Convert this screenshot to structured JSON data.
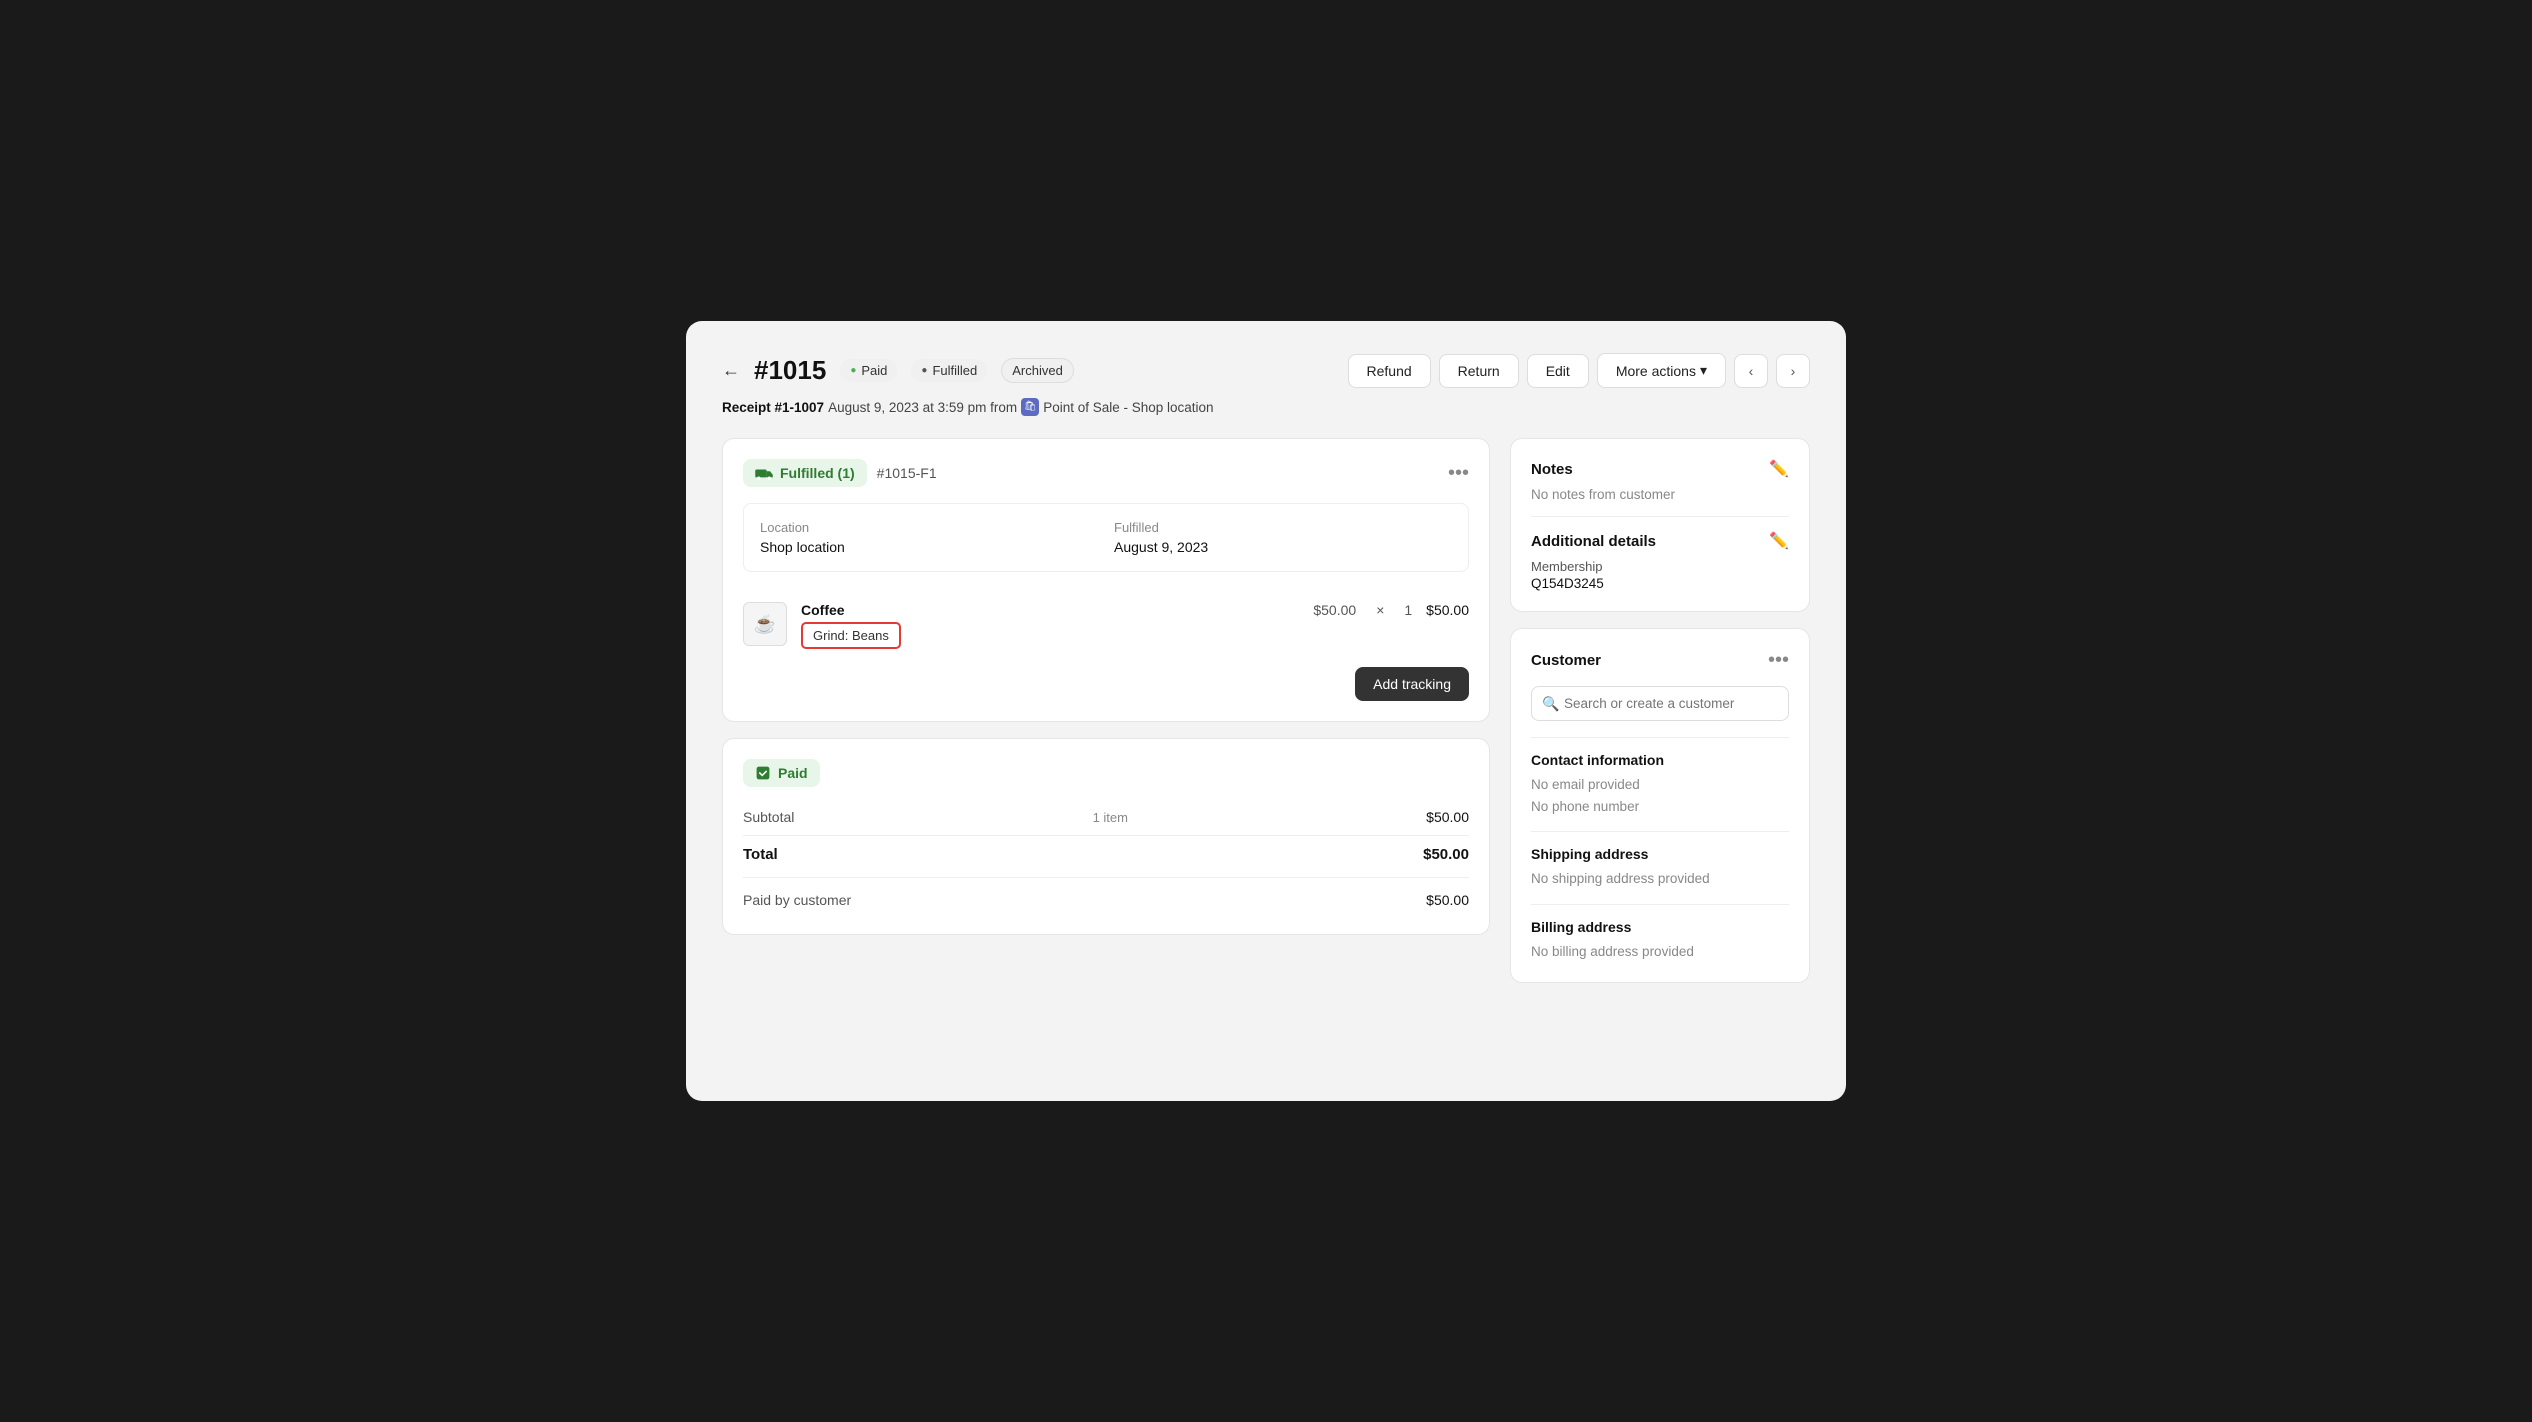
{
  "header": {
    "back_label": "←",
    "order_number": "#1015",
    "badge_paid": "Paid",
    "badge_fulfilled": "Fulfilled",
    "badge_archived": "Archived",
    "btn_refund": "Refund",
    "btn_return": "Return",
    "btn_edit": "Edit",
    "btn_more_actions": "More actions",
    "nav_prev": "‹",
    "nav_next": "›"
  },
  "subheader": {
    "receipt_label": "Receipt #1-1007",
    "separator": " - ",
    "date": "August 9, 2023 at 3:59 pm from",
    "pos_icon": "🛍",
    "location": "Point of Sale - Shop location"
  },
  "fulfilled_card": {
    "badge_label": "Fulfilled (1)",
    "fulfillment_id": "#1015-F1",
    "three_dots": "•••",
    "location_label": "Location",
    "location_value": "Shop location",
    "fulfilled_label": "Fulfilled",
    "fulfilled_date": "August 9, 2023",
    "product_icon": "☕",
    "product_name": "Coffee",
    "product_variant": "Grind: Beans",
    "product_price": "$50.00",
    "product_multiplier": "×",
    "product_qty": "1",
    "product_total": "$50.00",
    "add_tracking_btn": "Add tracking"
  },
  "paid_card": {
    "badge_label": "Paid",
    "subtotal_label": "Subtotal",
    "subtotal_items": "1 item",
    "subtotal_amount": "$50.00",
    "total_label": "Total",
    "total_amount": "$50.00",
    "paid_by_label": "Paid by customer",
    "paid_by_amount": "$50.00"
  },
  "notes_card": {
    "title": "Notes",
    "no_notes": "No notes from customer",
    "additional_title": "Additional details",
    "membership_label": "Membership",
    "membership_value": "Q154D3245"
  },
  "customer_card": {
    "title": "Customer",
    "three_dots": "•••",
    "search_placeholder": "Search or create a customer",
    "contact_title": "Contact information",
    "no_email": "No email provided",
    "no_phone": "No phone number",
    "shipping_title": "Shipping address",
    "no_shipping": "No shipping address provided",
    "billing_title": "Billing address",
    "no_billing": "No billing address provided"
  }
}
